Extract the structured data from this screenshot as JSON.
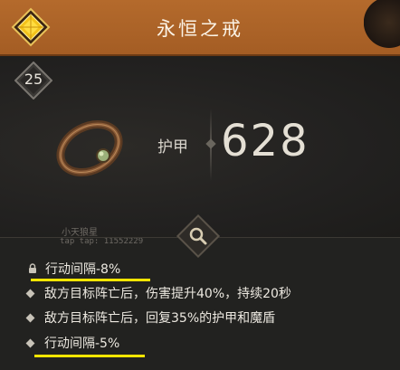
{
  "header": {
    "title": "永恒之戒",
    "rarity_color": "#f3c21a"
  },
  "item": {
    "level": "25",
    "stat_label": "护甲",
    "stat_value": "628"
  },
  "watermark": {
    "name": "小天狼星",
    "id": "tap tap: 11552229"
  },
  "affixes": [
    {
      "text": "行动间隔-8%",
      "locked": true,
      "highlighted": true
    },
    {
      "text": "敌方目标阵亡后，伤害提升40%，持续20秒",
      "locked": false,
      "highlighted": false
    },
    {
      "text": "敌方目标阵亡后，回复35%的护甲和魔盾",
      "locked": false,
      "highlighted": false
    },
    {
      "text": "行动间隔-5%",
      "locked": false,
      "highlighted": true
    }
  ],
  "icons": {
    "rarity": "diamond-rarity-icon",
    "level": "level-diamond-icon",
    "search": "magnifier-icon",
    "lock": "lock-icon",
    "item": "ring-icon"
  },
  "colors": {
    "header_bg": "#a85f27",
    "highlight": "#ffe600",
    "panel_bg": "#222220"
  }
}
